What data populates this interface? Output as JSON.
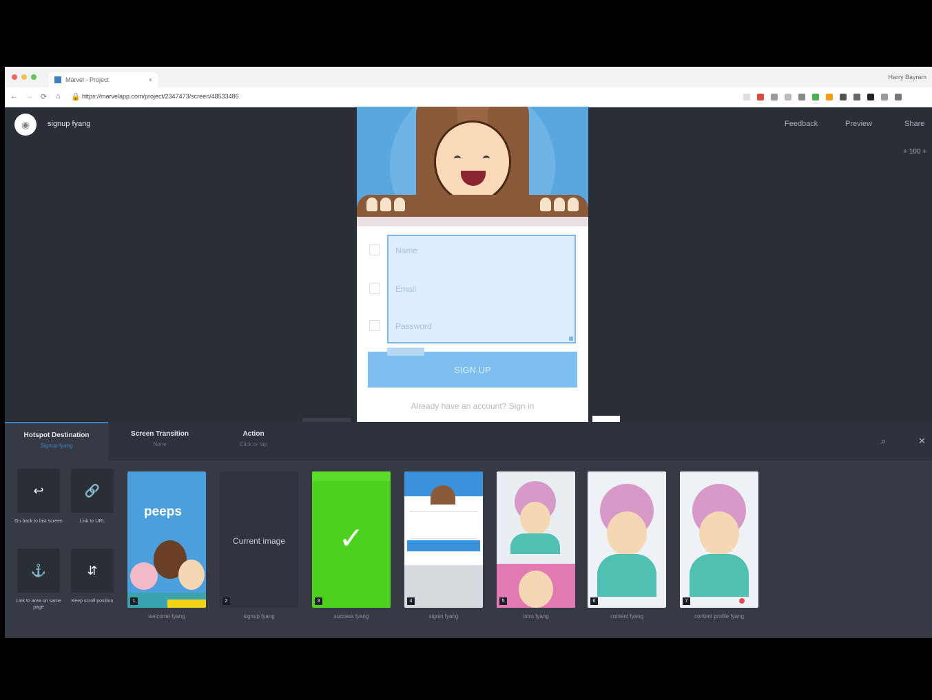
{
  "browser": {
    "tab_title": "Marvel - Project",
    "tab_close": "×",
    "user": "Harry Bayram",
    "url": "https://marvelapp.com/project/2347473/screen/48533486",
    "nav": {
      "back": "←",
      "forward": "→",
      "reload": "⟳",
      "home": "⌂"
    }
  },
  "header": {
    "project_name": "signup fyang",
    "links": [
      "Feedback",
      "Preview",
      "Share"
    ],
    "zoom": "+ 100 +"
  },
  "phone": {
    "fields": [
      "Name",
      "Email",
      "Password"
    ],
    "button": "SIGN UP",
    "already": "Already have an account?  Sign in"
  },
  "panel": {
    "tabs": [
      {
        "title": "Hotspot Destination",
        "sub": "Signup fyang"
      },
      {
        "title": "Screen Transition",
        "sub": "None"
      },
      {
        "title": "Action",
        "sub": "Click or tap"
      }
    ],
    "actions": [
      {
        "icon": "↩",
        "label": "Go back to last screen"
      },
      {
        "icon": "🔗",
        "label": "Link to URL"
      },
      {
        "icon": "⚓",
        "label": "Link to area on same page"
      },
      {
        "icon": "⇵",
        "label": "Keep scroll position"
      }
    ],
    "current_image": "Current image",
    "screens": [
      {
        "label": "welcome fyang",
        "num": "1",
        "brand": "peeps"
      },
      {
        "label": "signup fyang",
        "num": "2"
      },
      {
        "label": "success fyang",
        "num": "3"
      },
      {
        "label": "signin fyang",
        "num": "4"
      },
      {
        "label": "intro fyang",
        "num": "5"
      },
      {
        "label": "content fyang",
        "num": "6"
      },
      {
        "label": "content profile fyang",
        "num": "7"
      }
    ]
  }
}
